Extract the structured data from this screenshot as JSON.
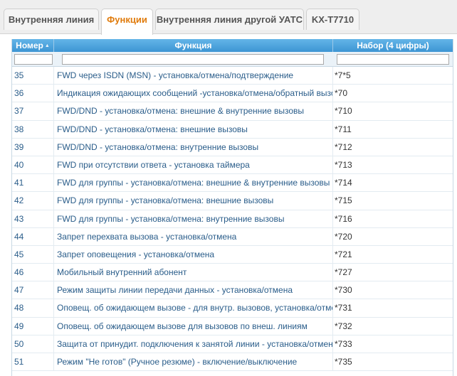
{
  "tabs": [
    {
      "label": "Внутренняя линия",
      "active": false
    },
    {
      "label": "Функции",
      "active": true
    },
    {
      "label": "Внутренняя линия другой УАТС",
      "active": false
    },
    {
      "label": "KX-T7710",
      "active": false
    }
  ],
  "table": {
    "columns": [
      "Номер",
      "Функция",
      "Набор (4 цифры)"
    ],
    "sort_icon": "sort-asc-icon",
    "filters": [
      "",
      "",
      ""
    ],
    "rows": [
      {
        "num": "35",
        "func": "FWD через ISDN (MSN) - установка/отмена/подтверждение",
        "code": "*7*5"
      },
      {
        "num": "36",
        "func": "Индикация ожидающих сообщений -установка/отмена/обратный вызов",
        "code": "*70"
      },
      {
        "num": "37",
        "func": "FWD/DND - установка/отмена: внешние & внутренние вызовы",
        "code": "*710"
      },
      {
        "num": "38",
        "func": "FWD/DND - установка/отмена: внешние вызовы",
        "code": "*711"
      },
      {
        "num": "39",
        "func": "FWD/DND - установка/отмена: внутренние вызовы",
        "code": "*712"
      },
      {
        "num": "40",
        "func": "FWD при отсутствии ответа - установка таймера",
        "code": "*713"
      },
      {
        "num": "41",
        "func": "FWD для группы - установка/отмена: внешние & внутренние вызовы",
        "code": "*714"
      },
      {
        "num": "42",
        "func": "FWD для группы - установка/отмена: внешние вызовы",
        "code": "*715"
      },
      {
        "num": "43",
        "func": "FWD для группы - установка/отмена: внутренние вызовы",
        "code": "*716"
      },
      {
        "num": "44",
        "func": "Запрет перехвата вызова - установка/отмена",
        "code": "*720"
      },
      {
        "num": "45",
        "func": "Запрет оповещения - установка/отмена",
        "code": "*721"
      },
      {
        "num": "46",
        "func": "Мобильный внутренний абонент",
        "code": "*727"
      },
      {
        "num": "47",
        "func": "Режим защиты линии передачи данных - установка/отмена",
        "code": "*730"
      },
      {
        "num": "48",
        "func": "Оповещ. об ожидающем вызове - для внутр. вызовов, установка/отмена",
        "code": "*731"
      },
      {
        "num": "49",
        "func": "Оповещ. об ожидающем вызове для вызовов по внеш. линиям",
        "code": "*732"
      },
      {
        "num": "50",
        "func": "Защита от принудит. подключения к занятой линии - установка/отмена",
        "code": "*733"
      },
      {
        "num": "51",
        "func": "Режим \"Не готов\" (Ручное резюме) - включение/выключение",
        "code": "*735"
      }
    ]
  }
}
